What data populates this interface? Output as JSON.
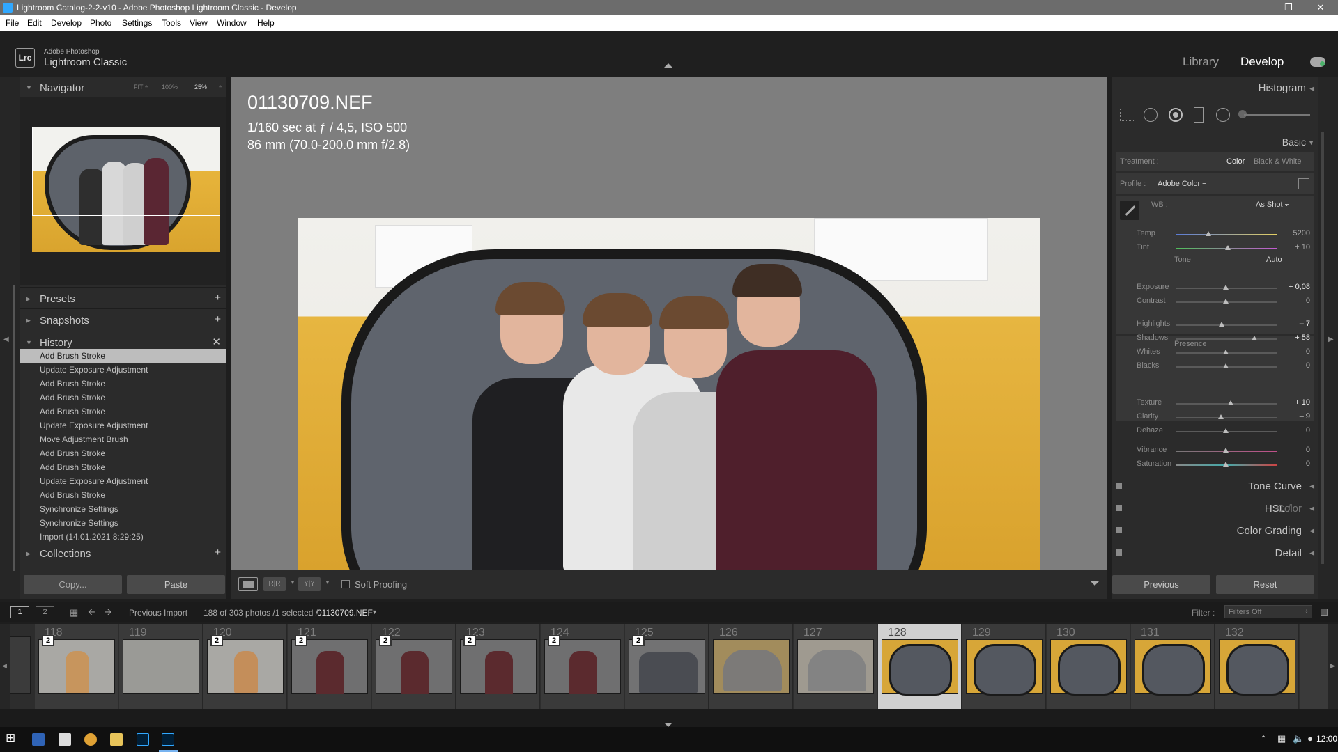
{
  "window": {
    "title": "Lightroom Catalog-2-2-v10 - Adobe Photoshop Lightroom Classic - Develop"
  },
  "menu": [
    "File",
    "Edit",
    "Develop",
    "Photo",
    "Settings",
    "Tools",
    "View",
    "Window",
    "Help"
  ],
  "brand": {
    "badge": "Lrc",
    "line1": "Adobe Photoshop",
    "line2": "Lightroom Classic"
  },
  "modules": {
    "library": "Library",
    "develop": "Develop"
  },
  "navigator": {
    "title": "Navigator",
    "fit": "FIT ÷",
    "zoom100": "100%",
    "zoom25": "25%",
    "zoomstep": "÷"
  },
  "left_panels": {
    "presets": "Presets",
    "snapshots": "Snapshots",
    "history": "History",
    "collections": "Collections"
  },
  "history": [
    "Add Brush Stroke",
    "Update Exposure Adjustment",
    "Add Brush Stroke",
    "Add Brush Stroke",
    "Add Brush Stroke",
    "Update Exposure Adjustment",
    "Move Adjustment Brush",
    "Add Brush Stroke",
    "Add Brush Stroke",
    "Update Exposure Adjustment",
    "Add Brush Stroke",
    "Synchronize Settings",
    "Synchronize Settings",
    "Import (14.01.2021 8:29:25)"
  ],
  "left_buttons": {
    "copy": "Copy...",
    "paste": "Paste"
  },
  "photo_info": {
    "filename": "01130709.NEF",
    "exposure": "1/160 sec at ƒ / 4,5, ISO 500",
    "lens": "86 mm (70.0-200.0 mm f/2.8)"
  },
  "toolbar": {
    "soft_proofing": "Soft Proofing"
  },
  "right": {
    "histogram": "Histogram",
    "basic": "Basic",
    "treatment_label": "Treatment :",
    "treatment_color": "Color",
    "treatment_bw": "Black & White",
    "profile_label": "Profile :",
    "profile_value": "Adobe Color ÷",
    "wb_label": "WB :",
    "wb_value": "As Shot ÷",
    "tone_label": "Tone",
    "auto": "Auto",
    "presence_label": "Presence",
    "tone_curve": "Tone Curve",
    "hsl": "HSL",
    "hsl_color": "Color",
    "color_grading": "Color Grading",
    "detail": "Detail",
    "previous": "Previous",
    "reset": "Reset"
  },
  "sliders": [
    {
      "label": "Temp",
      "value": "5200",
      "level": 0.33
    },
    {
      "label": "Tint",
      "value": "+ 10",
      "level": 0.53
    },
    {
      "label": "Exposure",
      "value": "+ 0,08",
      "level": 0.5
    },
    {
      "label": "Contrast",
      "value": "0",
      "level": 0.5
    },
    {
      "label": "Highlights",
      "value": "– 7",
      "level": 0.46
    },
    {
      "label": "Shadows",
      "value": "+ 58",
      "level": 0.78
    },
    {
      "label": "Whites",
      "value": "0",
      "level": 0.5
    },
    {
      "label": "Blacks",
      "value": "0",
      "level": 0.5
    },
    {
      "label": "Texture",
      "value": "+ 10",
      "level": 0.55
    },
    {
      "label": "Clarity",
      "value": "– 9",
      "level": 0.46
    },
    {
      "label": "Dehaze",
      "value": "0",
      "level": 0.5
    },
    {
      "label": "Vibrance",
      "value": "0",
      "level": 0.5
    },
    {
      "label": "Saturation",
      "value": "0",
      "level": 0.5
    }
  ],
  "filmbar": {
    "page1": "1",
    "page2": "2",
    "source": "Previous Import",
    "count": "188 of 303 photos /1 selected /",
    "file": "01130709.NEF",
    "filter_label": "Filter :",
    "filter_value": "Filters Off"
  },
  "filmstrip": [
    {
      "num": "118",
      "stack": "2",
      "tone": "#c7955d"
    },
    {
      "num": "119",
      "stack": "",
      "tone": "#9a9a96"
    },
    {
      "num": "120",
      "stack": "2",
      "tone": "#c48e5a"
    },
    {
      "num": "121",
      "stack": "2",
      "tone": "#5b2a2e"
    },
    {
      "num": "122",
      "stack": "2",
      "tone": "#5b2a2e"
    },
    {
      "num": "123",
      "stack": "2",
      "tone": "#5b2a2e"
    },
    {
      "num": "124",
      "stack": "2",
      "tone": "#5b2a2e"
    },
    {
      "num": "125",
      "stack": "2",
      "tone": "#4a4c52"
    },
    {
      "num": "126",
      "stack": "",
      "tone": "#a28c5c"
    },
    {
      "num": "127",
      "stack": "",
      "tone": "#9f9a90"
    },
    {
      "num": "128",
      "stack": "",
      "tone": "#d7a638"
    },
    {
      "num": "129",
      "stack": "",
      "tone": "#d7a638"
    },
    {
      "num": "130",
      "stack": "",
      "tone": "#d7a638"
    },
    {
      "num": "131",
      "stack": "",
      "tone": "#d7a638"
    },
    {
      "num": "132",
      "stack": "",
      "tone": "#d7a638"
    }
  ],
  "taskbar": {
    "clock": "12:00"
  }
}
